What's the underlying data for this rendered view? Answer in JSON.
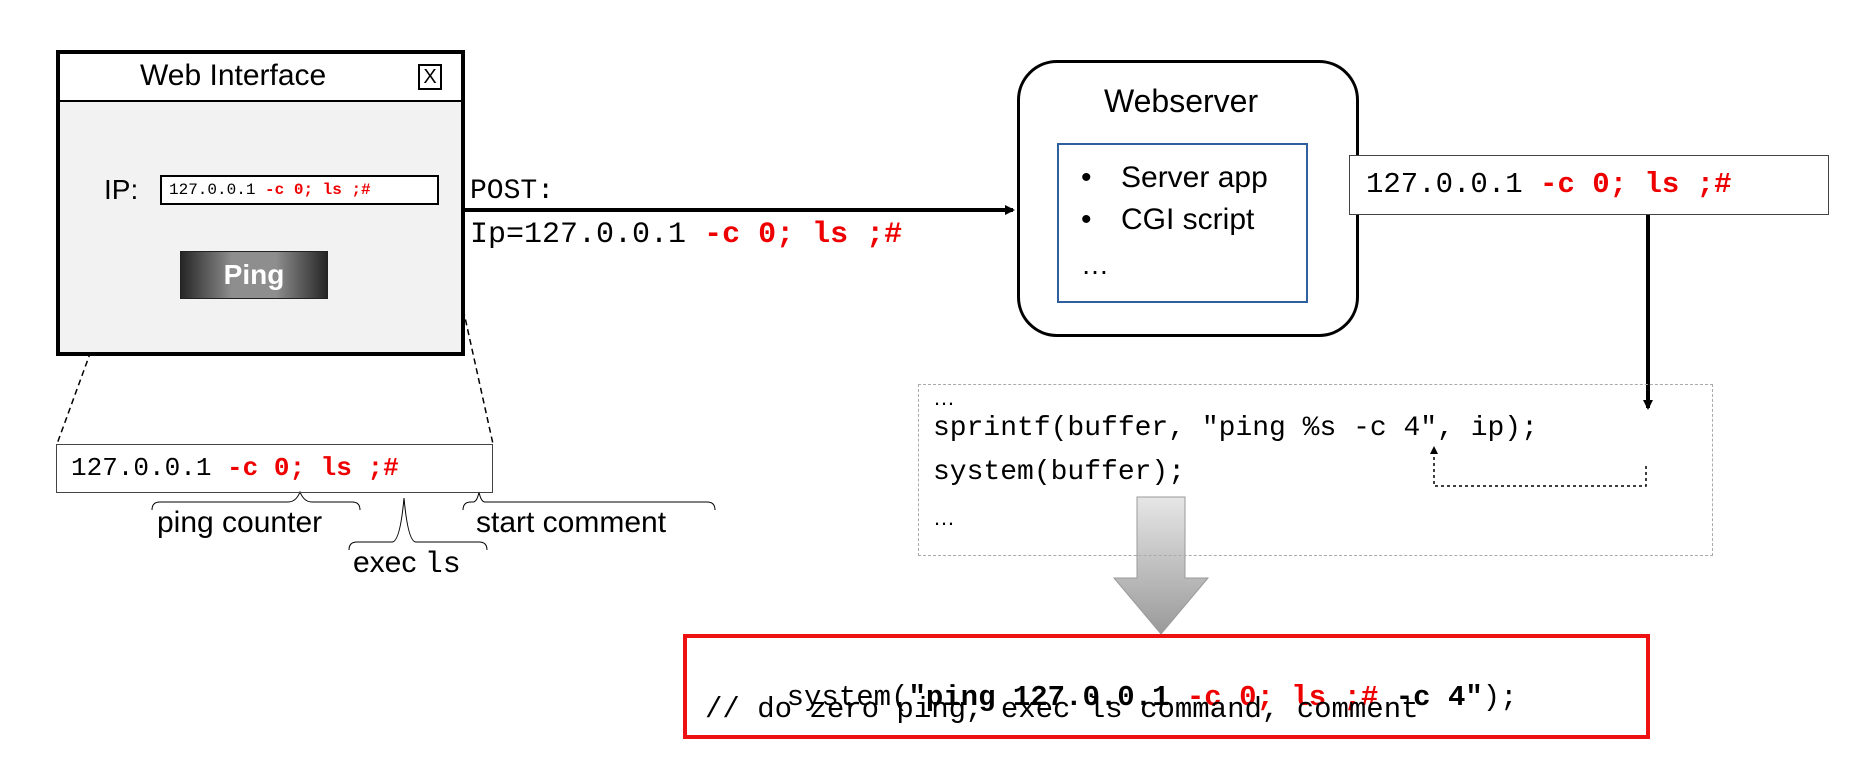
{
  "web_interface": {
    "title": "Web Interface",
    "close": "X",
    "ip_label": "IP:",
    "ip_input": {
      "plain": "127.0.0.1",
      "injected": "-c 0; ls ;#"
    },
    "ping_button": "Ping"
  },
  "zoom_input": {
    "plain": "127.0.0.1",
    "injected": "-c 0; ls ;#"
  },
  "annotations": {
    "ping_counter": "ping counter",
    "exec": "exec",
    "exec_cmd": "ls",
    "start_comment": "start comment"
  },
  "post_request": {
    "method": "POST:",
    "param": "Ip=127.0.0.1",
    "injected": "-c 0; ls ;#"
  },
  "webserver": {
    "title": "Webserver",
    "items": [
      "Server app",
      "CGI script"
    ],
    "ellipsis": "…"
  },
  "server_input": {
    "plain": "127.0.0.1",
    "injected": "-c 0; ls ;#"
  },
  "code": {
    "ellipsis_top": "…",
    "line1": "sprintf(buffer, \"ping %s -c 4\", ip);",
    "line2": "system(buffer);",
    "ellipsis_bottom": "…"
  },
  "result": {
    "prefix": "system(",
    "str_open": "\"ping 127.0.0.1",
    "injected": "-c 0; ls ;#",
    "str_close": "-c 4\"",
    "suffix": ");",
    "comment": "// do zero ping, exec ls command, comment"
  },
  "colors": {
    "injected": "#ee0000",
    "server_border": "#2e5f9e",
    "result_border": "#ee1111"
  }
}
